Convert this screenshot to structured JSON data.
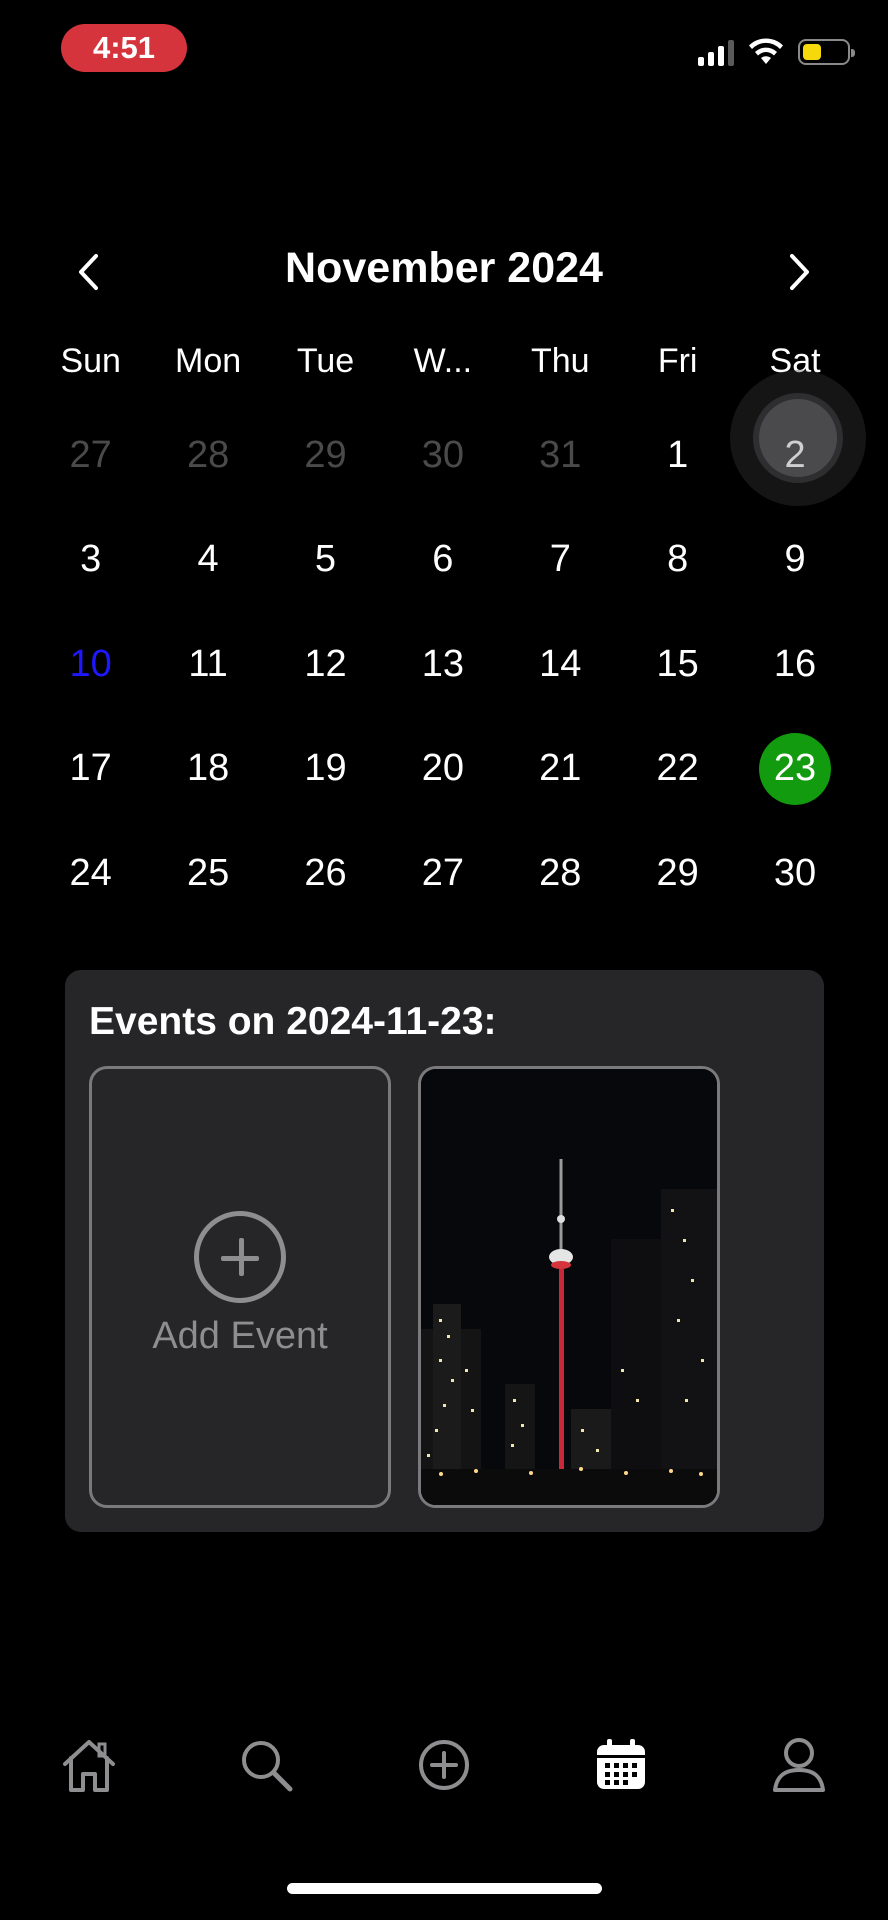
{
  "status_bar": {
    "time": "4:51"
  },
  "calendar": {
    "month_title": "November 2024",
    "weekdays": [
      "Sun",
      "Mon",
      "Tue",
      "W...",
      "Thu",
      "Fri",
      "Sat"
    ],
    "days": [
      {
        "label": "27",
        "state": "muted"
      },
      {
        "label": "28",
        "state": "muted"
      },
      {
        "label": "29",
        "state": "muted"
      },
      {
        "label": "30",
        "state": "muted"
      },
      {
        "label": "31",
        "state": "muted"
      },
      {
        "label": "1",
        "state": "normal"
      },
      {
        "label": "2",
        "state": "pressed"
      },
      {
        "label": "3",
        "state": "normal"
      },
      {
        "label": "4",
        "state": "normal"
      },
      {
        "label": "5",
        "state": "normal"
      },
      {
        "label": "6",
        "state": "normal"
      },
      {
        "label": "7",
        "state": "normal"
      },
      {
        "label": "8",
        "state": "normal"
      },
      {
        "label": "9",
        "state": "normal"
      },
      {
        "label": "10",
        "state": "today"
      },
      {
        "label": "11",
        "state": "normal"
      },
      {
        "label": "12",
        "state": "normal"
      },
      {
        "label": "13",
        "state": "normal"
      },
      {
        "label": "14",
        "state": "normal"
      },
      {
        "label": "15",
        "state": "normal"
      },
      {
        "label": "16",
        "state": "normal"
      },
      {
        "label": "17",
        "state": "normal"
      },
      {
        "label": "18",
        "state": "normal"
      },
      {
        "label": "19",
        "state": "normal"
      },
      {
        "label": "20",
        "state": "normal"
      },
      {
        "label": "21",
        "state": "normal"
      },
      {
        "label": "22",
        "state": "normal"
      },
      {
        "label": "23",
        "state": "selected"
      },
      {
        "label": "24",
        "state": "normal"
      },
      {
        "label": "25",
        "state": "normal"
      },
      {
        "label": "26",
        "state": "normal"
      },
      {
        "label": "27",
        "state": "normal"
      },
      {
        "label": "28",
        "state": "normal"
      },
      {
        "label": "29",
        "state": "normal"
      },
      {
        "label": "30",
        "state": "normal"
      }
    ],
    "colors": {
      "selected": "#139b0f",
      "today": "#1e17ff",
      "muted": "#4a4a4a"
    }
  },
  "events": {
    "title": "Events on 2024-11-23:",
    "add_label": "Add Event"
  },
  "tabbar": {
    "icons": [
      "home-icon",
      "search-icon",
      "add-circle-icon",
      "calendar-icon",
      "profile-icon"
    ],
    "active": "calendar-icon"
  }
}
